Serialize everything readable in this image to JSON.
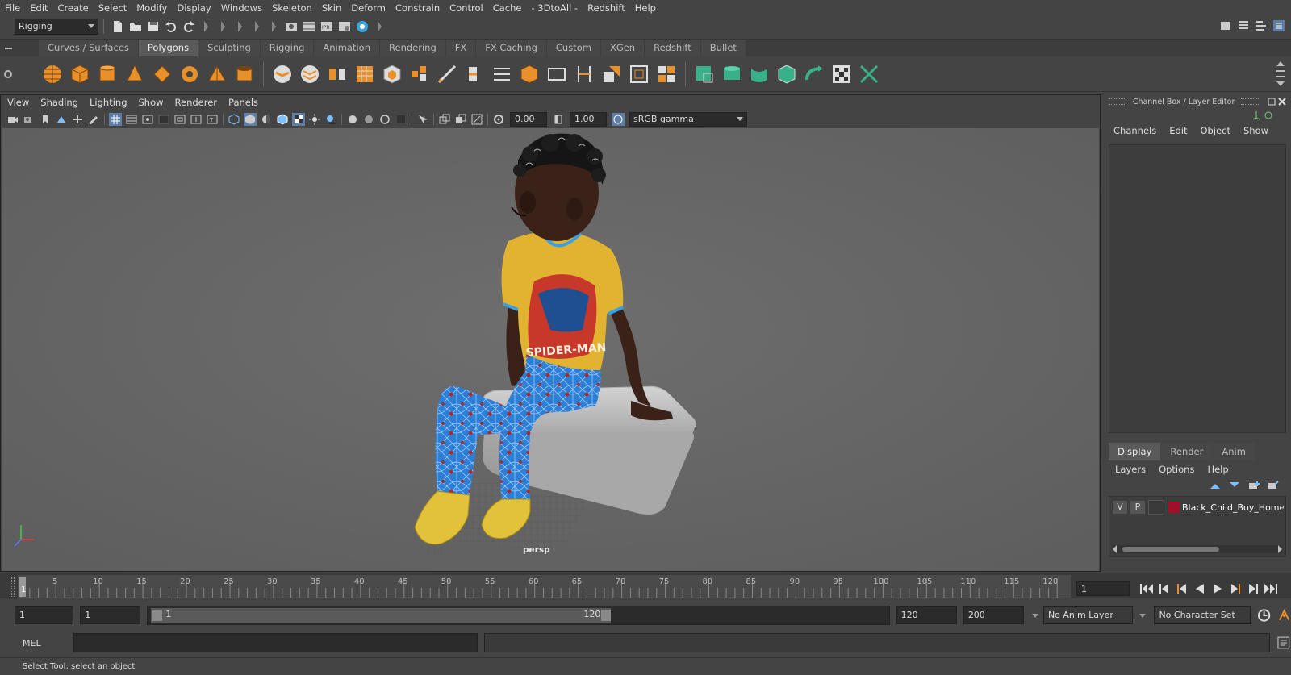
{
  "menubar": [
    "File",
    "Edit",
    "Create",
    "Select",
    "Modify",
    "Display",
    "Windows",
    "Skeleton",
    "Skin",
    "Deform",
    "Constrain",
    "Control",
    "Cache",
    "- 3DtoAll -",
    "Redshift",
    "Help"
  ],
  "statusline": {
    "mode": "Rigging"
  },
  "shelf": {
    "tabs": [
      "Curves / Surfaces",
      "Polygons",
      "Sculpting",
      "Rigging",
      "Animation",
      "Rendering",
      "FX",
      "FX Caching",
      "Custom",
      "XGen",
      "Redshift",
      "Bullet"
    ],
    "active_tab": "Polygons"
  },
  "viewport": {
    "menu": [
      "View",
      "Shading",
      "Lighting",
      "Show",
      "Renderer",
      "Panels"
    ],
    "exposure": "0.00",
    "gamma": "1.00",
    "colorspace": "sRGB gamma",
    "camera_label": "persp",
    "colors": {
      "shirt": "#e2b330",
      "pants": "#2d7fd6",
      "skin": "#3a2218",
      "bench": "#bdbdbd",
      "bg": "#666666"
    }
  },
  "channel_box": {
    "title": "Channel Box / Layer Editor",
    "menu": [
      "Channels",
      "Edit",
      "Object",
      "Show"
    ],
    "layer_tabs": [
      "Display",
      "Render",
      "Anim"
    ],
    "active_layer_tab": "Display",
    "layer_menu": [
      "Layers",
      "Options",
      "Help"
    ],
    "layer": {
      "v": "V",
      "p": "P",
      "name": "Black_Child_Boy_Home_S",
      "color": "#a0102a"
    }
  },
  "timeline": {
    "ticks": [
      "5",
      "10",
      "15",
      "20",
      "25",
      "30",
      "35",
      "40",
      "45",
      "50",
      "55",
      "60",
      "65",
      "70",
      "75",
      "80",
      "85",
      "90",
      "95",
      "100",
      "105",
      "110",
      "115",
      "120"
    ],
    "current_frame_marker": "1",
    "current_frame": "1"
  },
  "range": {
    "start": "1",
    "playback_start": "1",
    "slider_start": "1",
    "slider_end": "120",
    "playback_end": "120",
    "end": "200",
    "anim_layer": "No Anim Layer",
    "character_set": "No Character Set"
  },
  "commandline": {
    "label": "MEL"
  },
  "helpline": {
    "text": "Select Tool: select an object"
  }
}
